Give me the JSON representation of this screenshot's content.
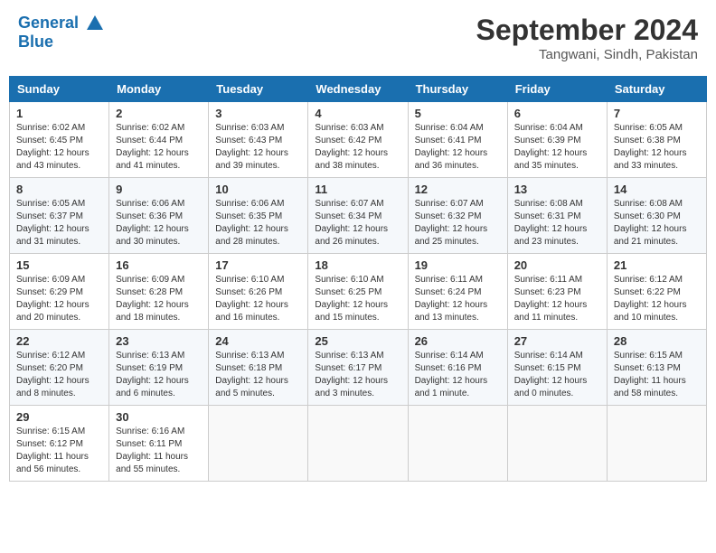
{
  "header": {
    "logo_line1": "General",
    "logo_line2": "Blue",
    "month": "September 2024",
    "location": "Tangwani, Sindh, Pakistan"
  },
  "weekdays": [
    "Sunday",
    "Monday",
    "Tuesday",
    "Wednesday",
    "Thursday",
    "Friday",
    "Saturday"
  ],
  "weeks": [
    [
      {
        "day": "1",
        "info": "Sunrise: 6:02 AM\nSunset: 6:45 PM\nDaylight: 12 hours\nand 43 minutes."
      },
      {
        "day": "2",
        "info": "Sunrise: 6:02 AM\nSunset: 6:44 PM\nDaylight: 12 hours\nand 41 minutes."
      },
      {
        "day": "3",
        "info": "Sunrise: 6:03 AM\nSunset: 6:43 PM\nDaylight: 12 hours\nand 39 minutes."
      },
      {
        "day": "4",
        "info": "Sunrise: 6:03 AM\nSunset: 6:42 PM\nDaylight: 12 hours\nand 38 minutes."
      },
      {
        "day": "5",
        "info": "Sunrise: 6:04 AM\nSunset: 6:41 PM\nDaylight: 12 hours\nand 36 minutes."
      },
      {
        "day": "6",
        "info": "Sunrise: 6:04 AM\nSunset: 6:39 PM\nDaylight: 12 hours\nand 35 minutes."
      },
      {
        "day": "7",
        "info": "Sunrise: 6:05 AM\nSunset: 6:38 PM\nDaylight: 12 hours\nand 33 minutes."
      }
    ],
    [
      {
        "day": "8",
        "info": "Sunrise: 6:05 AM\nSunset: 6:37 PM\nDaylight: 12 hours\nand 31 minutes."
      },
      {
        "day": "9",
        "info": "Sunrise: 6:06 AM\nSunset: 6:36 PM\nDaylight: 12 hours\nand 30 minutes."
      },
      {
        "day": "10",
        "info": "Sunrise: 6:06 AM\nSunset: 6:35 PM\nDaylight: 12 hours\nand 28 minutes."
      },
      {
        "day": "11",
        "info": "Sunrise: 6:07 AM\nSunset: 6:34 PM\nDaylight: 12 hours\nand 26 minutes."
      },
      {
        "day": "12",
        "info": "Sunrise: 6:07 AM\nSunset: 6:32 PM\nDaylight: 12 hours\nand 25 minutes."
      },
      {
        "day": "13",
        "info": "Sunrise: 6:08 AM\nSunset: 6:31 PM\nDaylight: 12 hours\nand 23 minutes."
      },
      {
        "day": "14",
        "info": "Sunrise: 6:08 AM\nSunset: 6:30 PM\nDaylight: 12 hours\nand 21 minutes."
      }
    ],
    [
      {
        "day": "15",
        "info": "Sunrise: 6:09 AM\nSunset: 6:29 PM\nDaylight: 12 hours\nand 20 minutes."
      },
      {
        "day": "16",
        "info": "Sunrise: 6:09 AM\nSunset: 6:28 PM\nDaylight: 12 hours\nand 18 minutes."
      },
      {
        "day": "17",
        "info": "Sunrise: 6:10 AM\nSunset: 6:26 PM\nDaylight: 12 hours\nand 16 minutes."
      },
      {
        "day": "18",
        "info": "Sunrise: 6:10 AM\nSunset: 6:25 PM\nDaylight: 12 hours\nand 15 minutes."
      },
      {
        "day": "19",
        "info": "Sunrise: 6:11 AM\nSunset: 6:24 PM\nDaylight: 12 hours\nand 13 minutes."
      },
      {
        "day": "20",
        "info": "Sunrise: 6:11 AM\nSunset: 6:23 PM\nDaylight: 12 hours\nand 11 minutes."
      },
      {
        "day": "21",
        "info": "Sunrise: 6:12 AM\nSunset: 6:22 PM\nDaylight: 12 hours\nand 10 minutes."
      }
    ],
    [
      {
        "day": "22",
        "info": "Sunrise: 6:12 AM\nSunset: 6:20 PM\nDaylight: 12 hours\nand 8 minutes."
      },
      {
        "day": "23",
        "info": "Sunrise: 6:13 AM\nSunset: 6:19 PM\nDaylight: 12 hours\nand 6 minutes."
      },
      {
        "day": "24",
        "info": "Sunrise: 6:13 AM\nSunset: 6:18 PM\nDaylight: 12 hours\nand 5 minutes."
      },
      {
        "day": "25",
        "info": "Sunrise: 6:13 AM\nSunset: 6:17 PM\nDaylight: 12 hours\nand 3 minutes."
      },
      {
        "day": "26",
        "info": "Sunrise: 6:14 AM\nSunset: 6:16 PM\nDaylight: 12 hours\nand 1 minute."
      },
      {
        "day": "27",
        "info": "Sunrise: 6:14 AM\nSunset: 6:15 PM\nDaylight: 12 hours\nand 0 minutes."
      },
      {
        "day": "28",
        "info": "Sunrise: 6:15 AM\nSunset: 6:13 PM\nDaylight: 11 hours\nand 58 minutes."
      }
    ],
    [
      {
        "day": "29",
        "info": "Sunrise: 6:15 AM\nSunset: 6:12 PM\nDaylight: 11 hours\nand 56 minutes."
      },
      {
        "day": "30",
        "info": "Sunrise: 6:16 AM\nSunset: 6:11 PM\nDaylight: 11 hours\nand 55 minutes."
      },
      {
        "day": "",
        "info": ""
      },
      {
        "day": "",
        "info": ""
      },
      {
        "day": "",
        "info": ""
      },
      {
        "day": "",
        "info": ""
      },
      {
        "day": "",
        "info": ""
      }
    ]
  ]
}
